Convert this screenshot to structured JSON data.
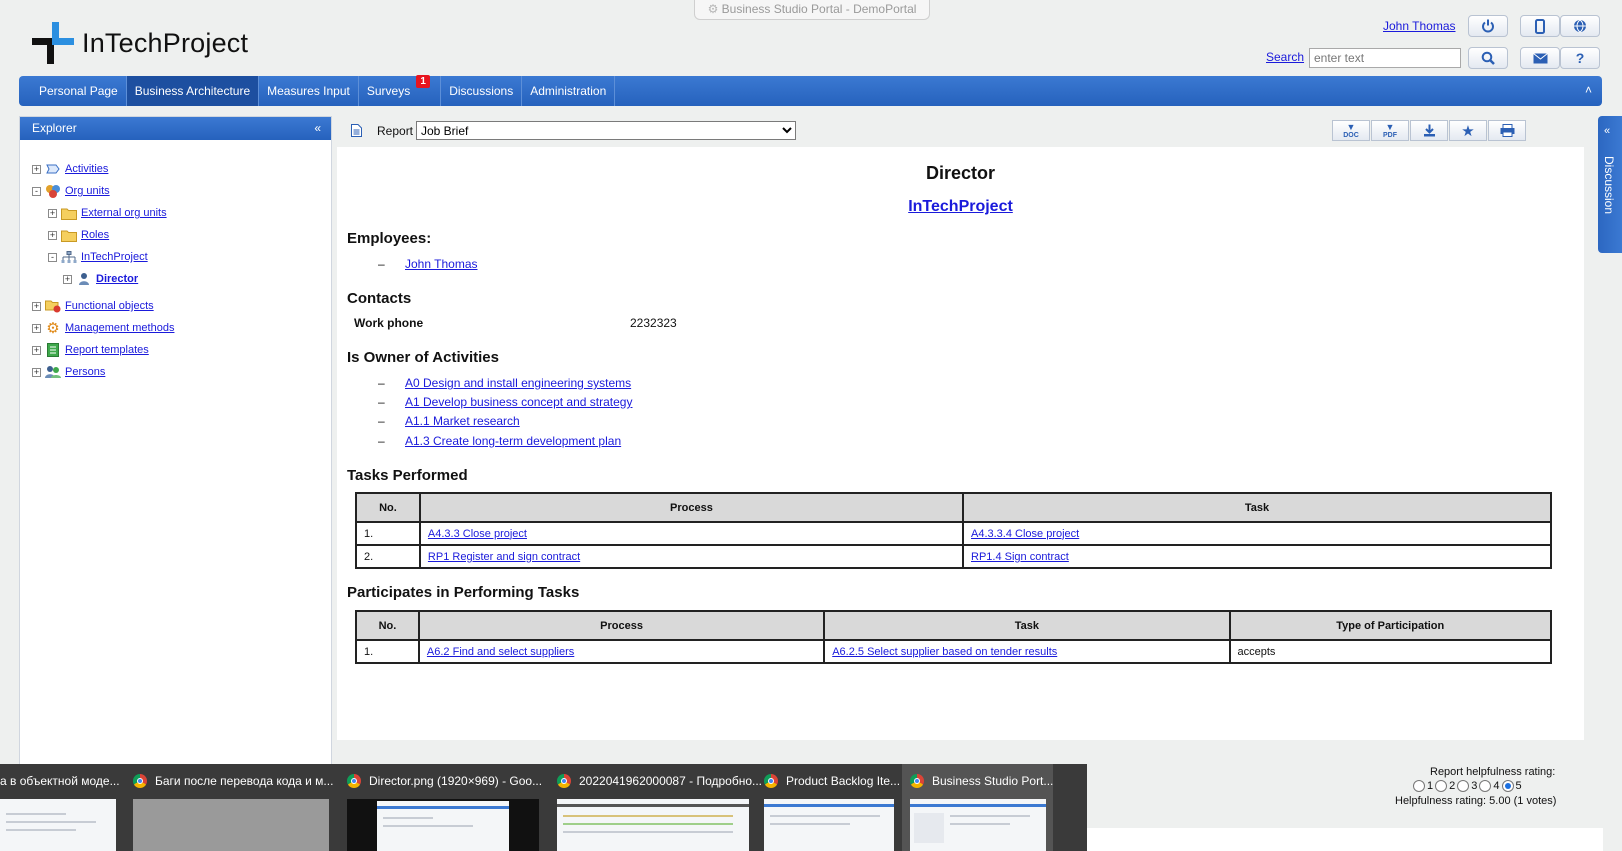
{
  "window_title": "Business Studio Portal - DemoPortal",
  "brand": {
    "name": "InTechProject"
  },
  "user_bar": {
    "user_name": "John Thomas",
    "search_label": "Search",
    "search_placeholder": "enter text",
    "icons": [
      "power-icon",
      "mobile-icon",
      "globe-icon",
      "search-icon",
      "mail-icon",
      "help-icon"
    ]
  },
  "nav": {
    "items": [
      {
        "label": "Personal Page"
      },
      {
        "label": "Business Architecture",
        "active": true
      },
      {
        "label": "Measures Input"
      },
      {
        "label": "Surveys",
        "badge": "1"
      },
      {
        "label": "Discussions"
      },
      {
        "label": "Administration"
      }
    ],
    "collapse_glyph": "˄"
  },
  "explorer": {
    "title": "Explorer",
    "collapse_glyph": "«",
    "tree": [
      {
        "label": "Activities",
        "icon": "activity-icon",
        "level": 0,
        "expander": "+"
      },
      {
        "label": "Org units",
        "icon": "org-units-icon",
        "level": 0,
        "expander": "-"
      },
      {
        "label": "External org units",
        "icon": "folder-icon",
        "level": 1,
        "expander": "+"
      },
      {
        "label": "Roles",
        "icon": "folder-icon",
        "level": 1,
        "expander": "+"
      },
      {
        "label": "InTechProject",
        "icon": "org-chart-icon",
        "level": 1,
        "expander": "-"
      },
      {
        "label": "Director",
        "icon": "person-icon",
        "level": 2,
        "expander": "+",
        "selected": true
      },
      {
        "label": "Functional objects",
        "icon": "functional-objects-icon",
        "level": 0,
        "expander": "+"
      },
      {
        "label": "Management methods",
        "icon": "gear-icon",
        "level": 0,
        "expander": "+"
      },
      {
        "label": "Report templates",
        "icon": "report-template-icon",
        "level": 0,
        "expander": "+"
      },
      {
        "label": "Persons",
        "icon": "persons-icon",
        "level": 0,
        "expander": "+"
      }
    ]
  },
  "report_toolbar": {
    "report_label": "Report",
    "selected_report": "Job Brief",
    "buttons": [
      {
        "name": "doc",
        "caption": "DOC"
      },
      {
        "name": "pdf",
        "caption": "PDF"
      },
      {
        "name": "download",
        "caption": ""
      },
      {
        "name": "favorite",
        "caption": ""
      },
      {
        "name": "print",
        "caption": ""
      }
    ]
  },
  "report": {
    "title": "Director",
    "subtitle": "InTechProject",
    "employees_heading": "Employees:",
    "employees": [
      "John Thomas"
    ],
    "contacts_heading": "Contacts",
    "contacts": [
      {
        "label": "Work phone",
        "value": "2232323"
      }
    ],
    "owner_heading": "Is Owner of Activities",
    "owned_activities": [
      "A0 Design and install engineering systems",
      "A1 Develop business concept and strategy",
      "A1.1 Market research",
      "A1.3 Create long-term development plan"
    ],
    "dash": "–",
    "tasks_heading": "Tasks Performed",
    "tasks_columns": [
      "No.",
      "Process",
      "Task"
    ],
    "tasks_rows": [
      [
        "1.",
        "A4.3.3 Close project",
        "A4.3.3.4 Close project"
      ],
      [
        "2.",
        "RP1 Register and sign contract",
        "RP1.4 Sign contract"
      ]
    ],
    "participates_heading": "Participates in Performing Tasks",
    "participates_columns": [
      "No.",
      "Process",
      "Task",
      "Type of Participation"
    ],
    "participates_rows": [
      [
        "1.",
        "A6.2 Find and select suppliers",
        "A6.2.5 Select supplier based on tender results",
        "accepts"
      ]
    ]
  },
  "discussion_tab": {
    "label": "Discussion",
    "arrow": "«"
  },
  "rating": {
    "title": "Report helpfulness rating:",
    "options": [
      "1",
      "2",
      "3",
      "4",
      "5"
    ],
    "selected": "5",
    "summary": "Helpfulness rating: 5.00 (1 votes)"
  },
  "taskbar": {
    "windows": [
      {
        "title": "а в объектной моде...",
        "icon": "",
        "active": false
      },
      {
        "title": "Баги после перевода кода и м...",
        "icon": "chrome-icon",
        "active": false
      },
      {
        "title": "Director.png (1920×969) - Goo...",
        "icon": "chrome-icon",
        "active": false
      },
      {
        "title": "2022041962000087 - Подробно...",
        "icon": "chrome-icon",
        "active": false
      },
      {
        "title": "Product Backlog Ite...",
        "icon": "chrome-icon",
        "active": false
      },
      {
        "title": "Business Studio Port...",
        "icon": "chrome-icon",
        "active": true
      }
    ]
  },
  "colors": {
    "accent": "#2f6cc8",
    "link": "#1a1adb",
    "badge": "#e8141e",
    "table_header": "#d9d9d9"
  }
}
